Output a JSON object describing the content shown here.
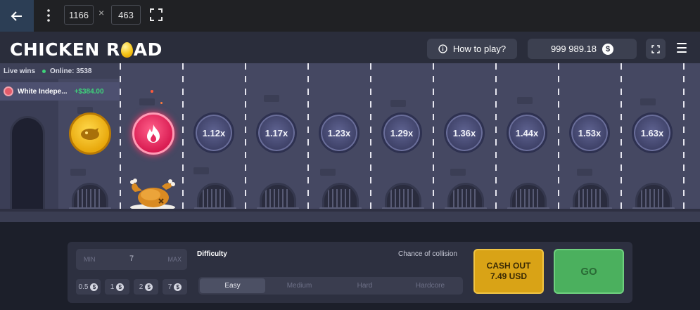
{
  "devtools": {
    "width_value": "1166",
    "times_sign": "×",
    "height_value": "463"
  },
  "header": {
    "logo_left": "CHICKEN R",
    "logo_right": "AD",
    "how_to_play": "How to play?",
    "balance": "999 989.18",
    "currency_symbol": "$"
  },
  "feed": {
    "live_wins_label": "Live wins",
    "online_label": "Online: 3538",
    "entries": [
      {
        "player": "White Indepe...",
        "amount": "+$384.00"
      }
    ]
  },
  "lanes": {
    "multipliers": [
      "1.12x",
      "1.17x",
      "1.23x",
      "1.29x",
      "1.36x",
      "1.44x",
      "1.53x",
      "1.63x"
    ]
  },
  "controls": {
    "bet": {
      "min_label": "MIN",
      "max_label": "MAX",
      "value": "7"
    },
    "quick_bets": [
      "0.5",
      "1",
      "2",
      "7"
    ],
    "chip_currency": "$",
    "difficulty_label": "Difficulty",
    "chance_label": "Chance of collision",
    "difficulty_options": [
      "Easy",
      "Medium",
      "Hard",
      "Hardcore"
    ],
    "selected_difficulty": "Easy",
    "cashout_line1": "CASH OUT",
    "cashout_line2": "7.49 USD",
    "go_label": "GO"
  },
  "colors": {
    "scene": "#454862",
    "multiplier_coin": "#3d4066",
    "cashout": "#d9a316",
    "go": "#4bb05e",
    "win_amount": "#3ed37a"
  }
}
